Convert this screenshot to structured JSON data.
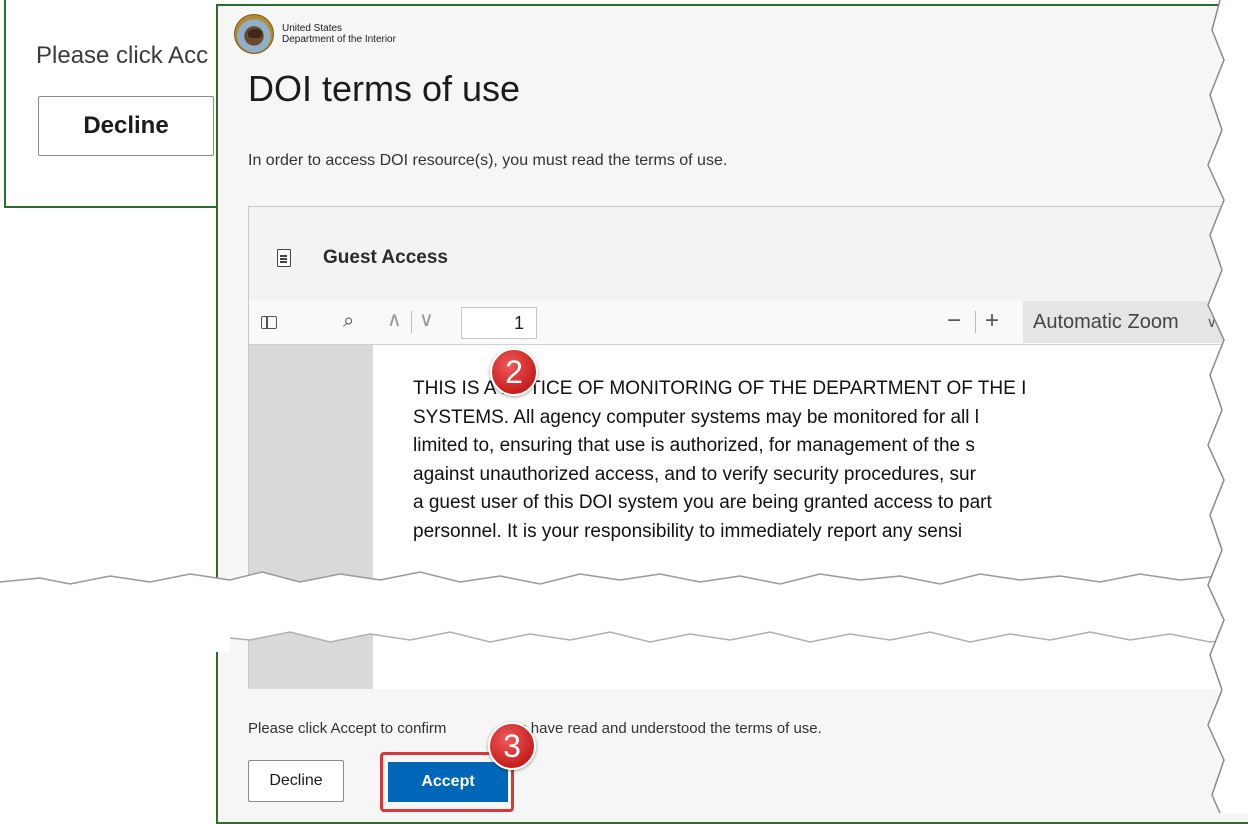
{
  "background_dialog": {
    "prompt_fragment": "Please click Acc",
    "decline_label": "Decline"
  },
  "organization": {
    "line1": "United States",
    "line2": "Department of the Interior"
  },
  "dialog": {
    "title": "DOI terms of use",
    "intro": "In order to access DOI resource(s), you must read the terms of use."
  },
  "document": {
    "name": "Guest Access",
    "page_number": "1",
    "zoom": "Automatic Zoom",
    "lines": [
      "THIS IS A NOTICE OF MONITORING OF THE DEPARTMENT OF THE I",
      "SYSTEMS. All agency computer systems may be monitored for all l",
      "limited to, ensuring that use is authorized, for management of the s",
      "against unauthorized access, and to verify security procedures, sur",
      "a guest user of this DOI system you are being granted access to part",
      "personnel. It is your responsibility to immediately report any sensi"
    ]
  },
  "footer": {
    "consent_text_before": "Please click Accept to confirm",
    "consent_text_after": "you have read and understood the terms of use.",
    "decline_label": "Decline",
    "accept_label": "Accept"
  },
  "callouts": {
    "step2": "2",
    "step3": "3"
  },
  "colors": {
    "frame_border": "#2e6b2e",
    "accept_bg": "#0067b8",
    "highlight": "#d9363a",
    "callout": "#d42a2a"
  },
  "icons": [
    "document-icon",
    "sidebar-toggle-icon",
    "search-icon",
    "chevron-up-icon",
    "chevron-down-icon",
    "minus-icon",
    "plus-icon",
    "dropdown-chevron-icon",
    "doi-seal-icon"
  ]
}
